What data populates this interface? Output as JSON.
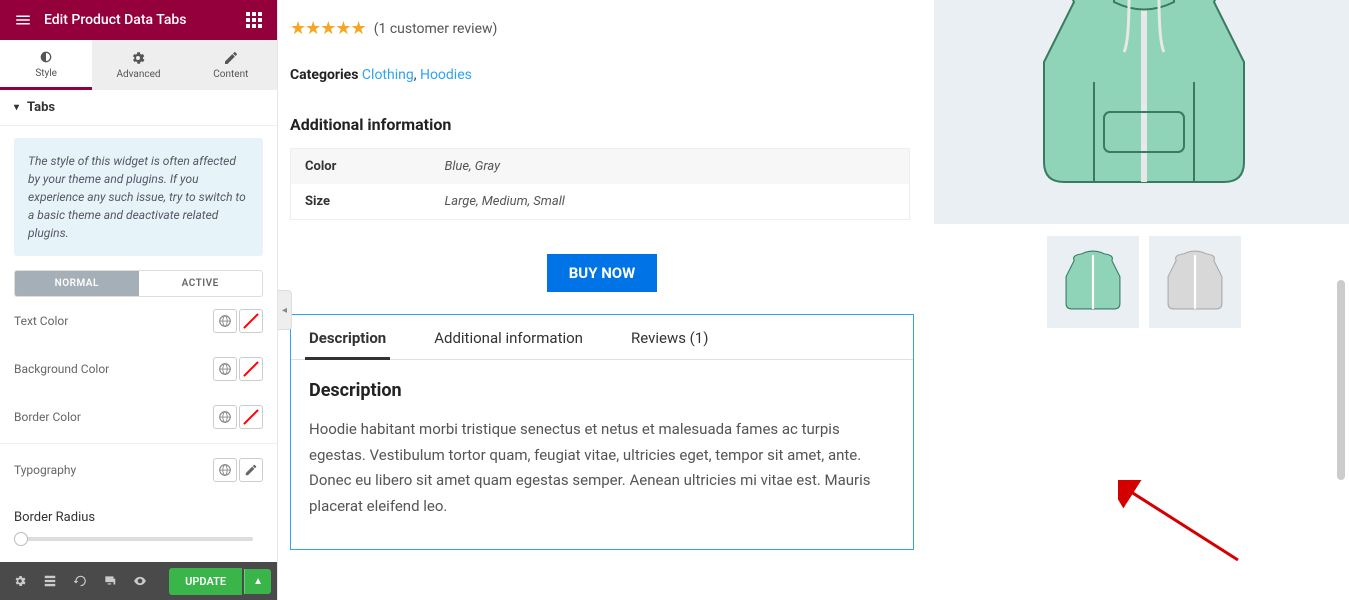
{
  "header": {
    "title": "Edit Product Data Tabs"
  },
  "panel_tabs": {
    "style": "Style",
    "advanced": "Advanced",
    "content": "Content"
  },
  "section": {
    "title": "Tabs"
  },
  "notice": "The style of this widget is often affected by your theme and plugins. If you experience any such issue, try to switch to a basic theme and deactivate related plugins.",
  "state_tabs": {
    "normal": "NORMAL",
    "active": "ACTIVE"
  },
  "controls": {
    "text_color": "Text Color",
    "background_color": "Background Color",
    "border_color": "Border Color",
    "typography": "Typography",
    "border_radius": "Border Radius"
  },
  "footer": {
    "update": "UPDATE"
  },
  "product": {
    "review_text": "(1 customer review)",
    "categories_label": "Categories",
    "categories": [
      "Clothing",
      "Hoodies"
    ],
    "additional_info_title": "Additional information",
    "attrs": [
      {
        "name": "Color",
        "value": "Blue, Gray"
      },
      {
        "name": "Size",
        "value": "Large, Medium, Small"
      }
    ],
    "buy_label": "BUY NOW"
  },
  "widget": {
    "tabs": {
      "description": "Description",
      "additional": "Additional information",
      "reviews": "Reviews (1)"
    },
    "heading": "Description",
    "body": "Hoodie habitant morbi tristique senectus et netus et malesuada fames ac turpis egestas. Vestibulum tortor quam, feugiat vitae, ultricies eget, tempor sit amet, ante. Donec eu libero sit amet quam egestas semper. Aenean ultricies mi vitae est. Mauris placerat eleifend leo."
  }
}
